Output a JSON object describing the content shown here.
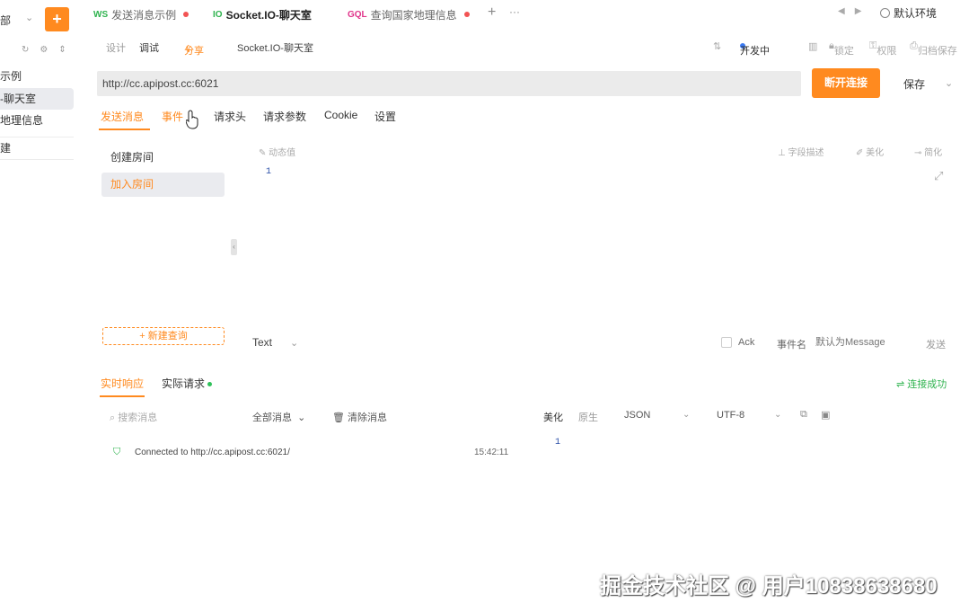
{
  "sidebar": {
    "scope": "部",
    "add_label": "+",
    "items": [
      {
        "label": "示例"
      },
      {
        "label": "-聊天室"
      },
      {
        "label": "地理信息"
      },
      {
        "label": "建"
      }
    ]
  },
  "tabs": [
    {
      "proto": "WS",
      "label": "发送消息示例",
      "unsaved": true
    },
    {
      "proto": "IO",
      "label": "Socket.IO-聊天室",
      "unsaved": false
    },
    {
      "proto": "GQL",
      "label": "查询国家地理信息",
      "unsaved": true
    }
  ],
  "env": {
    "label": "默认环境"
  },
  "subbar": {
    "design": "设计",
    "debug": "调试",
    "share": "分享",
    "title": "Socket.IO-聊天室",
    "status": "开发中",
    "lock": "锁定",
    "permission": "权限",
    "archive": "归档保存"
  },
  "url": {
    "value": "http://cc.apipost.cc:6021"
  },
  "buttons": {
    "disconnect": "断开连接",
    "save": "保存"
  },
  "request_tabs": [
    "发送消息",
    "事件",
    "请求头",
    "请求参数",
    "Cookie",
    "设置"
  ],
  "events": [
    {
      "label": "创建房间"
    },
    {
      "label": "加入房间"
    }
  ],
  "new_query": "新建查询",
  "editor": {
    "dynamic_value": "动态值",
    "field_desc": "字段描述",
    "beautify": "美化",
    "simplify": "简化",
    "line1": "1"
  },
  "send_row": {
    "format": "Text",
    "ack": "Ack",
    "event_name_label": "事件名",
    "event_name_placeholder": "默认为Message",
    "send": "发送"
  },
  "response": {
    "tabs": [
      "实时响应",
      "实际请求"
    ],
    "status": "连接成功",
    "search_placeholder": "搜索消息",
    "filter": "全部消息",
    "clear": "清除消息",
    "beautify": "美化",
    "raw": "原生",
    "format": "JSON",
    "encoding": "UTF-8",
    "messages": [
      {
        "text": "Connected to http://cc.apipost.cc:6021/",
        "time": "15:42:11"
      }
    ],
    "line1": "1"
  },
  "watermark": "掘金技术社区 @ 用户10838638680"
}
